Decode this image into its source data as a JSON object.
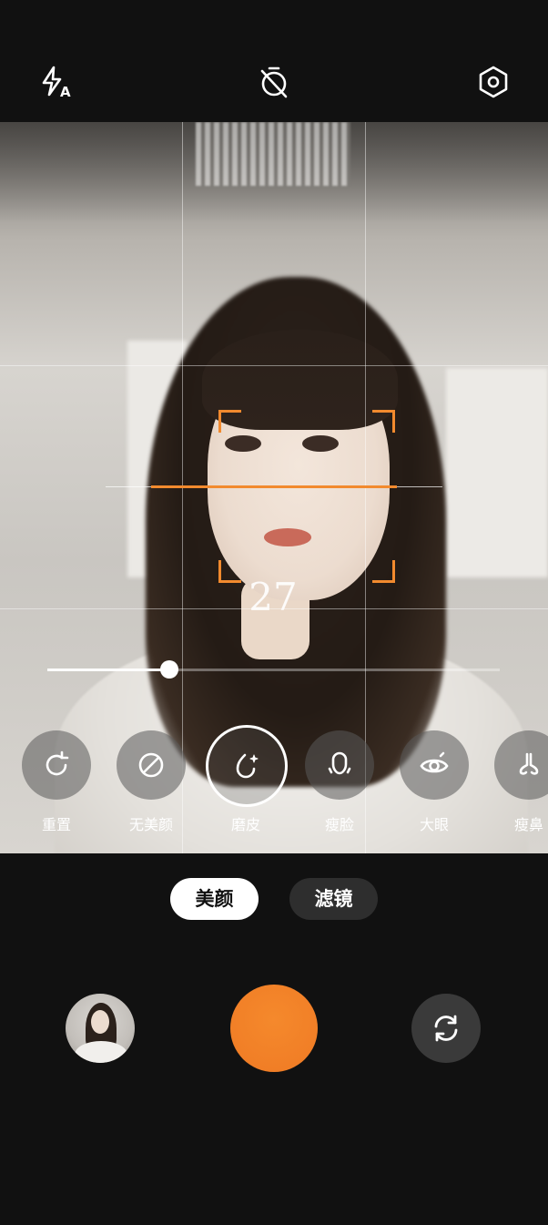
{
  "top_bar": {
    "flash_icon": "flash-auto-icon",
    "timer_icon": "timer-off-icon",
    "settings_icon": "settings-icon"
  },
  "viewfinder": {
    "beauty_level": "27",
    "slider_fraction": 0.27
  },
  "beauty_options": [
    {
      "label": "重置",
      "icon": "reset-icon"
    },
    {
      "label": "无美颜",
      "icon": "no-beauty-icon"
    },
    {
      "label": "磨皮",
      "icon": "smooth-skin-icon",
      "selected": true
    },
    {
      "label": "瘦脸",
      "icon": "slim-face-icon"
    },
    {
      "label": "大眼",
      "icon": "big-eye-icon"
    },
    {
      "label": "瘦鼻",
      "icon": "slim-nose-icon"
    }
  ],
  "mode_tabs": {
    "active": "美颜",
    "inactive": "滤镜"
  },
  "bottom": {
    "gallery_icon": "gallery-thumbnail",
    "shutter_icon": "shutter-button",
    "switch_icon": "switch-camera-icon"
  },
  "colors": {
    "accent": "#f28a2e",
    "background": "#111111"
  }
}
